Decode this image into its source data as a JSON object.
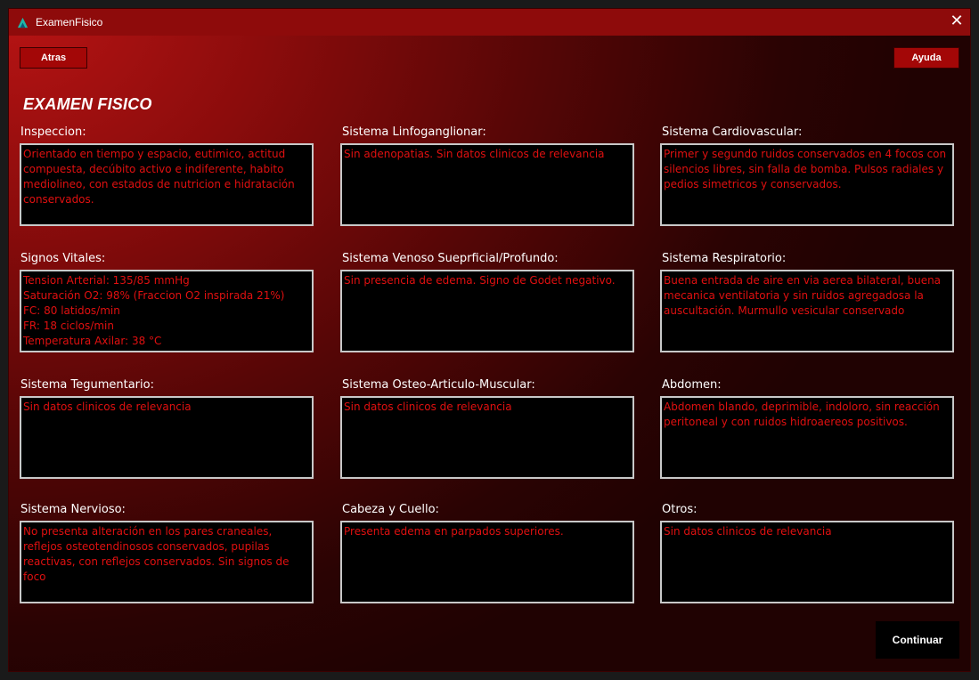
{
  "window": {
    "title": "ExamenFisico",
    "icon": "app-logo-icon",
    "close_glyph": "✕"
  },
  "toolbar": {
    "back_label": "Atras",
    "help_label": "Ayuda"
  },
  "page": {
    "title": "EXAMEN FISICO"
  },
  "fields": [
    {
      "label": "Inspeccion:",
      "value": "Orientado en tiempo y espacio, eutimico, actitud compuesta, decúbito activo e indiferente, habito mediolineo, con estados de nutricion e hidratación conservados."
    },
    {
      "label": "Sistema Linfoganglionar:",
      "value": "Sin adenopatias. Sin datos clinicos de relevancia"
    },
    {
      "label": "Sistema Cardiovascular:",
      "value": "Primer y segundo ruidos conservados en 4 focos con silencios libres, sin falla de bomba. Pulsos radiales y pedios simetricos y conservados."
    },
    {
      "label": "Signos Vitales:",
      "value": "Tension Arterial: 135/85 mmHg\nSaturación O2: 98% (Fraccion O2 inspirada 21%)\nFC: 80 latidos/min\nFR: 18 ciclos/min\nTemperatura Axilar: 38 °C"
    },
    {
      "label": "Sistema Venoso Sueprficial/Profundo:",
      "value": "Sin presencia de edema. Signo de Godet negativo."
    },
    {
      "label": "Sistema Respiratorio:",
      "value": "Buena entrada de aire en via aerea bilateral, buena mecanica ventilatoria y sin ruidos agregadosa la auscultación. Murmullo vesicular conservado"
    },
    {
      "label": "Sistema Tegumentario:",
      "value": "Sin datos clinicos de relevancia"
    },
    {
      "label": "Sistema Osteo-Articulo-Muscular:",
      "value": "Sin datos clinicos de relevancia"
    },
    {
      "label": "Abdomen:",
      "value": "Abdomen blando, deprimible, indoloro, sin reacción peritoneal y con ruidos hidroaereos positivos."
    },
    {
      "label": "Sistema Nervioso:",
      "value": "No presenta alteración en los pares craneales, reflejos osteotendinosos conservados, pupilas reactivas, con reflejos conservados. Sin signos de foco"
    },
    {
      "label": "Cabeza y Cuello:",
      "value": "Presenta edema en parpados superiores."
    },
    {
      "label": "Otros:",
      "value": "Sin datos clinicos de relevancia"
    }
  ],
  "footer": {
    "continue_label": "Continuar"
  },
  "colors": {
    "accent": "#a30707",
    "text_red": "#e01010",
    "field_bg": "#000000",
    "field_border": "#c8c8c8"
  }
}
